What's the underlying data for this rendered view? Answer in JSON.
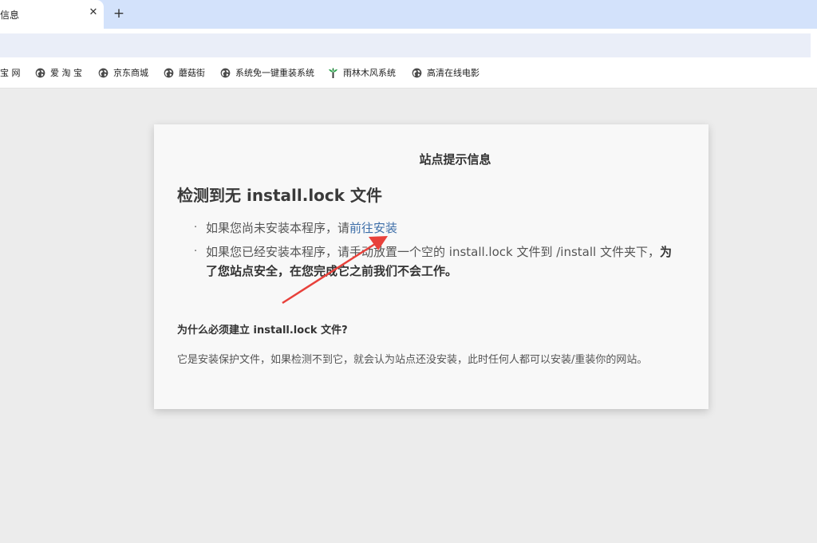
{
  "browser": {
    "tab_title": "信息",
    "tab_close": "✕",
    "new_tab": "+"
  },
  "bookmarks": [
    {
      "label": "宝 网",
      "icon": "globe-icon"
    },
    {
      "label": "爱 淘 宝",
      "icon": "globe-icon"
    },
    {
      "label": "京东商城",
      "icon": "globe-icon"
    },
    {
      "label": "蘑菇街",
      "icon": "globe-icon"
    },
    {
      "label": "系统免一键重装系统",
      "icon": "globe-icon"
    },
    {
      "label": "雨林木风系统",
      "icon": "tree-icon"
    },
    {
      "label": "高清在线电影",
      "icon": "globe-icon"
    }
  ],
  "card": {
    "heading": "站点提示信息",
    "title": "检测到无 install.lock 文件",
    "bullet": "·",
    "item1_text": "如果您尚未安装本程序，请",
    "item1_link": "前往安装",
    "item2_text": "如果您已经安装本程序，请手动放置一个空的 install.lock 文件到 /install 文件夹下，",
    "item2_strong": "为了您站点安全，在您完成它之前我们不会工作。",
    "question": "为什么必须建立 install.lock 文件?",
    "answer": "它是安装保护文件，如果检测不到它，就会认为站点还没安装，此时任何人都可以安装/重装你的网站。"
  },
  "colors": {
    "link": "#3d6ea8",
    "arrow": "#e8413b",
    "tabstrip": "#d3e2fb"
  }
}
